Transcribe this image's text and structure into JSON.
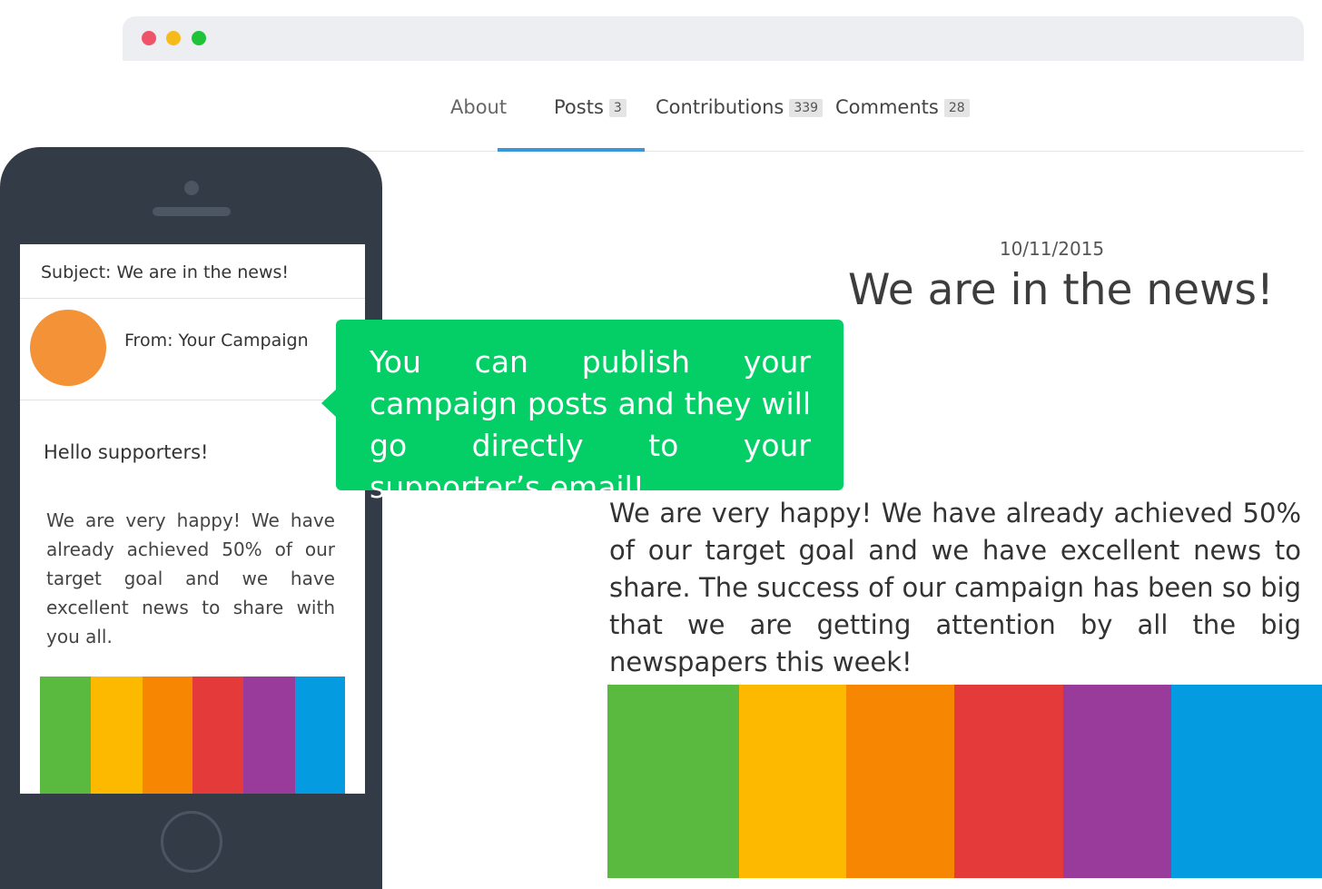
{
  "window": {
    "controls": [
      "close",
      "minimize",
      "maximize"
    ]
  },
  "tabs": [
    {
      "label": "About",
      "count": null
    },
    {
      "label": "Posts",
      "count": "3"
    },
    {
      "label": "Contributions",
      "count": "339"
    },
    {
      "label": "Comments",
      "count": "28"
    }
  ],
  "active_tab": "Posts",
  "post": {
    "date": "10/11/2015",
    "title": "We are in the news!",
    "body": "We are very happy! We have already achieved 50% of our target goal and we have excellent news to share. The success of our campaign has been so big that we are getting attention by all the big newspapers this week!"
  },
  "email": {
    "subject": "Subject: We are in the news!",
    "from": "From: Your Campaign",
    "greeting": "Hello supporters!",
    "body": "We are very happy! We have already achieved 50% of our target goal and we have excellent news to share with you all."
  },
  "callout": {
    "text": "You can publish your campaign posts and they will go directly to your supporter’s email!"
  },
  "colors": {
    "accent": "#3a97d7",
    "callout": "#04cf66",
    "avatar": "#f39237",
    "stripes": [
      "#5aba3f",
      "#fdb900",
      "#f78603",
      "#e53a3a",
      "#983b9a",
      "#059be0"
    ]
  }
}
